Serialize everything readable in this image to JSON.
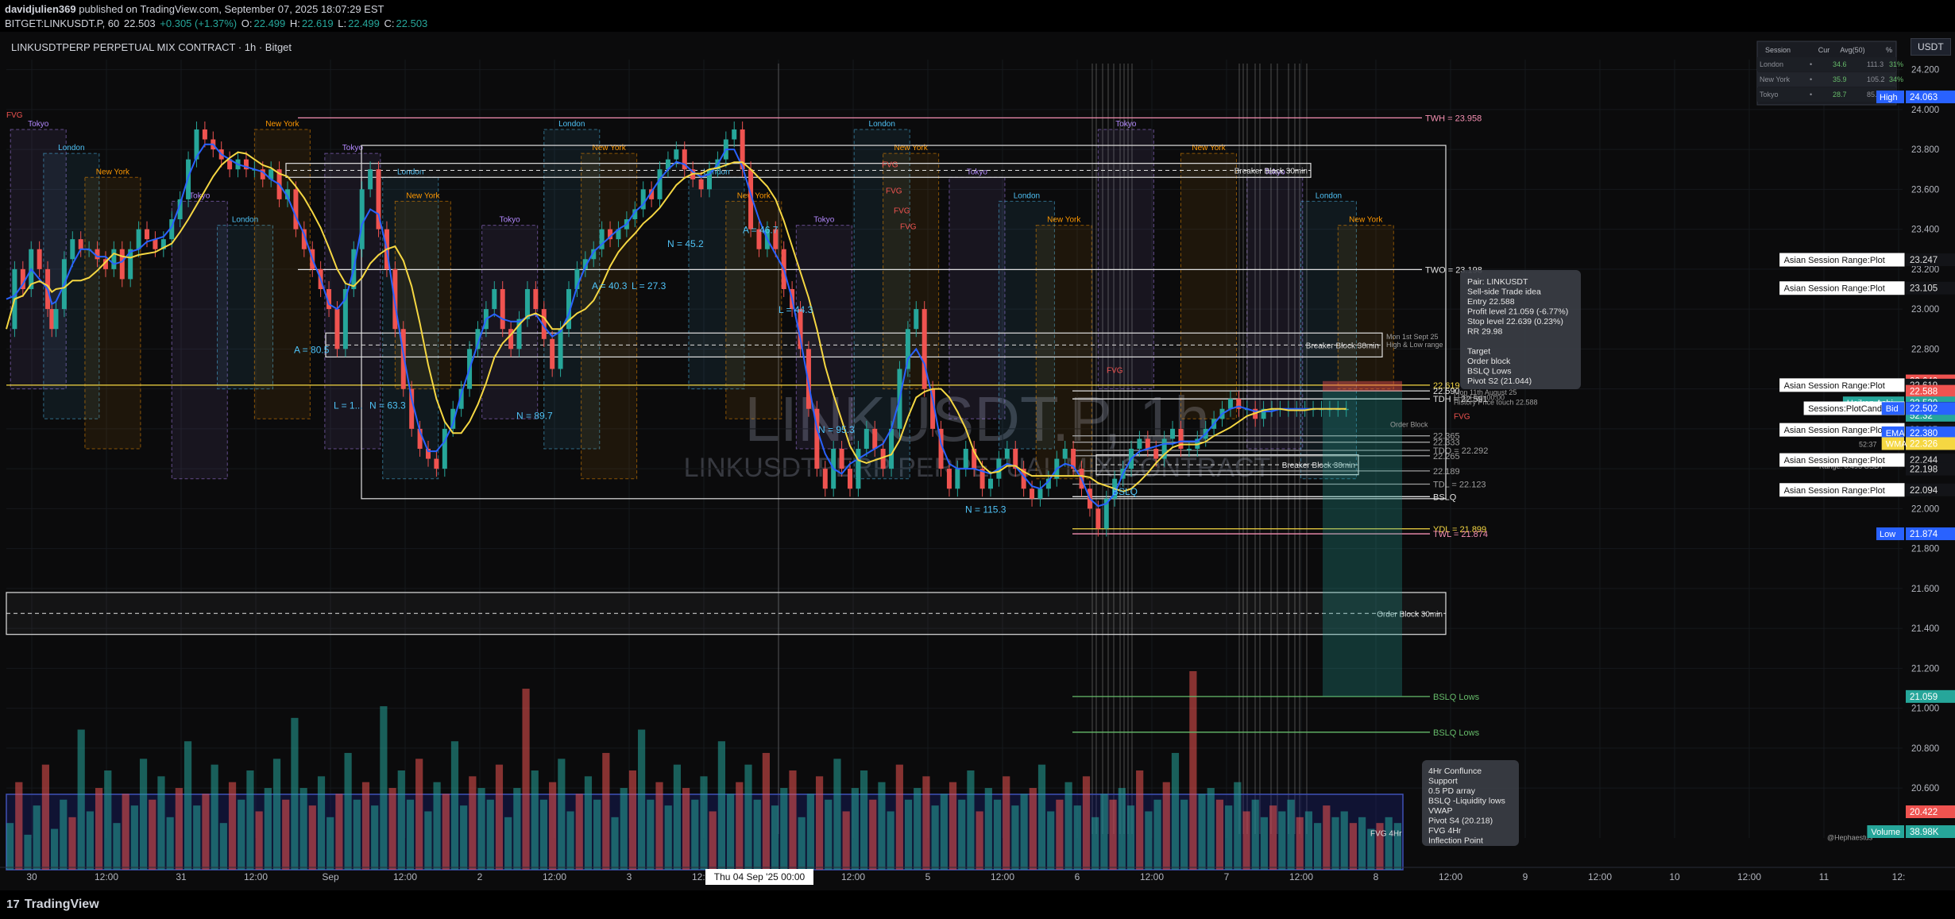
{
  "header": {
    "user": "davidjulien369",
    "published": "published on TradingView.com, September 07, 2025 18:07:29 EST",
    "symbol": "BITGET:LINKUSDT.P, 60",
    "last": "22.503",
    "change": "+0.305 (+1.37%)",
    "open_label": "O:",
    "open": "22.499",
    "high_label": "H:",
    "high": "22.619",
    "low_label": "L:",
    "low": "22.499",
    "close_label": "C:",
    "close": "22.503"
  },
  "chart_title": "LINKUSDTPERP PERPETUAL MIX CONTRACT · 1h · Bitget",
  "currency_button": "USDT",
  "watermark": {
    "big": "LINKUSDT.P, 1h",
    "small": "LINKUSDTPERP PERPETUAL MIX CONTRACT"
  },
  "session_table": {
    "headers": [
      "Session",
      "Cur",
      "Avg(50)",
      "%"
    ],
    "rows": [
      [
        "London",
        "•",
        "34.6",
        "111.3",
        "31%"
      ],
      [
        "New York",
        "•",
        "35.9",
        "105.2",
        "34%"
      ],
      [
        "Tokyo",
        "•",
        "28.7",
        "85.6",
        ""
      ]
    ]
  },
  "footer": {
    "logo": "TradingView",
    "logo_mark": "17"
  },
  "colors": {
    "bull": "#26a69a",
    "bear": "#ef5350",
    "ema": "#2962ff",
    "wma": "#f5d742",
    "tokyo": "#b388ff",
    "london": "#4fc3f7",
    "newyork": "#ff9800",
    "bg": "#0b0b0c"
  },
  "chart_data": {
    "type": "line",
    "title": "LINKUSDTPERP PERPETUAL MIX CONTRACT · 1h · Bitget",
    "ylim": [
      20.3,
      24.25
    ],
    "y_ticks": [
      "24.200",
      "24.000",
      "23.800",
      "23.600",
      "23.400",
      "23.200",
      "23.000",
      "22.800",
      "22.600",
      "22.400",
      "22.200",
      "22.000",
      "21.800",
      "21.600",
      "21.400",
      "21.200",
      "21.000",
      "20.800",
      "20.600"
    ],
    "x_ticks": [
      "30",
      "12:00",
      "31",
      "12:00",
      "Sep",
      "12:00",
      "2",
      "12:00",
      "3",
      "12:00",
      "Thu 04 Sep '25   00:00",
      "12:00",
      "5",
      "12:00",
      "6",
      "12:00",
      "7",
      "12:00",
      "8",
      "12:00",
      "9",
      "12:00",
      "10",
      "12:00",
      "11",
      "12:"
    ],
    "price_series": {
      "name": "LINKUSDT.P",
      "t": [
        0,
        10,
        20,
        30,
        40,
        50,
        55,
        60,
        70,
        80,
        90,
        100,
        110,
        120,
        130,
        140,
        150,
        160,
        170,
        180,
        190,
        200,
        210,
        220,
        230,
        240,
        250,
        260,
        270,
        280,
        290,
        300,
        310,
        320,
        330,
        340,
        350,
        360,
        370,
        380,
        390,
        400,
        410,
        420,
        430,
        440,
        450,
        460,
        470,
        480,
        490,
        500,
        510,
        520,
        530,
        540,
        550,
        560,
        570,
        580,
        590,
        600,
        610,
        620,
        630,
        640,
        650,
        660,
        670,
        680,
        690,
        700,
        710,
        720,
        730,
        740,
        750,
        760,
        770,
        780,
        790,
        800,
        810,
        820,
        830,
        840,
        850,
        860,
        870,
        880,
        890,
        900,
        910,
        920,
        930,
        940,
        950,
        960,
        970,
        980,
        990,
        1000,
        1010,
        1020,
        1030,
        1040,
        1050,
        1060,
        1070,
        1080,
        1090,
        1100,
        1110,
        1120,
        1130,
        1140,
        1150,
        1160,
        1170,
        1180,
        1190,
        1200,
        1210,
        1220,
        1230,
        1240,
        1250,
        1260,
        1270,
        1280,
        1290,
        1300,
        1310,
        1320,
        1330,
        1340,
        1350,
        1360,
        1370,
        1380,
        1390,
        1400,
        1410,
        1420,
        1430,
        1440,
        1450,
        1460,
        1470,
        1480,
        1490,
        1500,
        1510,
        1520,
        1530,
        1540,
        1550,
        1560,
        1570,
        1580,
        1590,
        1600,
        1610,
        1620,
        1630,
        1640,
        1650,
        1660,
        1670,
        1680,
        1690
      ],
      "values": [
        22.9,
        23.2,
        23.1,
        23.3,
        23.2,
        23.0,
        22.9,
        23.0,
        23.25,
        23.35,
        23.3,
        23.3,
        23.25,
        23.2,
        23.3,
        23.15,
        23.3,
        23.4,
        23.35,
        23.3,
        23.35,
        23.45,
        23.55,
        23.75,
        23.9,
        23.85,
        23.8,
        23.75,
        23.7,
        23.75,
        23.7,
        23.7,
        23.65,
        23.7,
        23.55,
        23.6,
        23.4,
        23.3,
        23.2,
        23.1,
        23.0,
        22.8,
        23.1,
        23.3,
        23.6,
        23.7,
        23.4,
        23.2,
        22.9,
        22.6,
        22.4,
        22.3,
        22.25,
        22.2,
        22.4,
        22.5,
        22.6,
        22.8,
        22.9,
        23.0,
        23.1,
        22.9,
        22.8,
        22.95,
        23.1,
        23.0,
        22.85,
        22.7,
        22.9,
        23.1,
        23.2,
        23.25,
        23.3,
        23.4,
        23.35,
        23.4,
        23.45,
        23.5,
        23.6,
        23.55,
        23.7,
        23.75,
        23.8,
        23.7,
        23.65,
        23.6,
        23.7,
        23.75,
        23.85,
        23.9,
        23.7,
        23.4,
        23.3,
        23.4,
        23.3,
        23.1,
        23.0,
        22.8,
        22.5,
        22.2,
        22.1,
        22.3,
        22.2,
        22.1,
        22.3,
        22.4,
        22.3,
        22.2,
        22.4,
        22.7,
        22.9,
        23.0,
        22.6,
        22.4,
        22.2,
        22.1,
        22.2,
        22.3,
        22.2,
        22.1,
        22.15,
        22.25,
        22.3,
        22.2,
        22.1,
        22.05,
        22.1,
        22.15,
        22.25,
        22.3,
        22.2,
        22.1,
        22.0,
        21.9,
        22.05,
        22.15,
        22.2,
        22.3,
        22.35,
        22.3,
        22.25,
        22.35,
        22.4,
        22.3,
        22.3,
        22.35,
        22.4,
        22.45,
        22.5,
        22.55,
        22.5,
        22.5,
        22.45,
        22.5,
        22.5,
        22.5,
        22.5,
        22.5,
        22.5,
        22.5,
        22.5,
        22.5,
        22.5,
        22.5
      ]
    },
    "ema_label": "EMA",
    "ema_value": "22.380",
    "wma_label": "WMA",
    "wma_value": "22.326",
    "price_tags": [
      {
        "label": "",
        "value": "24.063",
        "name": "High",
        "color": "#2962ff"
      },
      {
        "label": "Asian Session Range:Plot",
        "value": "23.247",
        "color": "#0b0b0c"
      },
      {
        "label": "Asian Session Range:Plot",
        "value": "23.105",
        "color": "#0b0b0c"
      },
      {
        "label": "",
        "value": "22.640",
        "color": "#ef5350"
      },
      {
        "label": "Asian Session Range:Plot",
        "value": "22.619",
        "color": "#0b0b0c"
      },
      {
        "label": "",
        "value": "22.588",
        "color": "#ef5350"
      },
      {
        "label": "Heiken Ashi",
        "value": "22.530",
        "color": "#26a69a"
      },
      {
        "label": "Ask",
        "value": "22.503",
        "color": "#ef5350"
      },
      {
        "label": "LINKUSDT.P",
        "value": "22.503",
        "color": "#26a69a"
      },
      {
        "label": "",
        "value": "52:32",
        "color": "#26a69a"
      },
      {
        "label": "Sessions:PlotCandle",
        "value": "22.503",
        "color": "#0b0b0c"
      },
      {
        "label": "Bid",
        "value": "22.502",
        "color": "#2962ff"
      },
      {
        "label": "Asian Session Range:Plot",
        "value": "22.395",
        "color": "#0b0b0c"
      },
      {
        "label": "EMA",
        "value": "22.380",
        "color": "#2962ff"
      },
      {
        "label": "WMA",
        "value": "22.326",
        "color": "#f5d742"
      },
      {
        "label": "Asian Session Range:Plot",
        "value": "22.244",
        "color": "#0b0b0c"
      },
      {
        "label": "",
        "value": "22.198",
        "color": "#0b0b0c"
      },
      {
        "label": "Asian Session Range:Plot",
        "value": "22.094",
        "color": "#0b0b0c"
      },
      {
        "label": "",
        "value": "21.874",
        "name": "Low",
        "color": "#2962ff"
      },
      {
        "label": "",
        "value": "21.059",
        "color": "#26a69a"
      },
      {
        "label": "",
        "value": "20.422",
        "color": "#ef5350"
      },
      {
        "label": "Volume",
        "value": "38.98K",
        "color": "#26a69a"
      }
    ],
    "levels": [
      {
        "label": "TWH = 23.958",
        "value": 23.958,
        "color": "#f48fb1"
      },
      {
        "label": "TWO = 23.198",
        "value": 23.198,
        "color": "#e0e0e0"
      },
      {
        "label": "22.619",
        "value": 22.619,
        "color": "#f5d742"
      },
      {
        "label": "22.590",
        "value": 22.59,
        "color": "#e0e0e0"
      },
      {
        "label": "TDH = 22.591",
        "value": 22.55,
        "color": "#e0e0e0"
      },
      {
        "label": "22.365",
        "value": 22.365,
        "color": "#9e9e9e"
      },
      {
        "label": "22.333",
        "value": 22.333,
        "color": "#9e9e9e"
      },
      {
        "label": "TDO = 22.292",
        "value": 22.292,
        "color": "#9e9e9e"
      },
      {
        "label": "22.265",
        "value": 22.265,
        "color": "#9e9e9e"
      },
      {
        "label": "22.189",
        "value": 22.189,
        "color": "#9e9e9e"
      },
      {
        "label": "TDL = 22.123",
        "value": 22.123,
        "color": "#9e9e9e"
      },
      {
        "label": "BSLQ",
        "value": 22.06,
        "color": "#e0e0e0"
      },
      {
        "label": "YDL = 21.899",
        "value": 21.899,
        "color": "#f5d742"
      },
      {
        "label": "TWL = 21.874",
        "value": 21.874,
        "color": "#f48fb1"
      },
      {
        "label": "BSLQ Lows",
        "value": 21.059,
        "color": "#66bb6a"
      },
      {
        "label": "BSLQ Lows",
        "value": 20.88,
        "color": "#66bb6a"
      }
    ],
    "boxes": [
      {
        "label": "Breaker Block 30min",
        "y1": 23.73,
        "y2": 23.66
      },
      {
        "label": "Breaker Block 30min",
        "y1": 22.88,
        "y2": 22.76
      },
      {
        "label": "Order Block 30min",
        "y1": 21.58,
        "y2": 21.37
      },
      {
        "label": "Breaker Block 30min",
        "y1": 22.27,
        "y2": 22.17
      }
    ],
    "sessions": [
      {
        "name": "Tokyo",
        "t": 5
      },
      {
        "name": "London",
        "t": 45
      },
      {
        "name": "New York",
        "t": 95
      },
      {
        "name": "Tokyo",
        "t": 200
      },
      {
        "name": "London",
        "t": 255
      },
      {
        "name": "New York",
        "t": 300
      },
      {
        "name": "Tokyo",
        "t": 385
      },
      {
        "name": "London",
        "t": 455
      },
      {
        "name": "New York",
        "t": 470
      },
      {
        "name": "Tokyo",
        "t": 575
      },
      {
        "name": "London",
        "t": 650
      },
      {
        "name": "New York",
        "t": 695
      },
      {
        "name": "London",
        "t": 825
      },
      {
        "name": "New York",
        "t": 870
      },
      {
        "name": "Tokyo",
        "t": 955
      },
      {
        "name": "London",
        "t": 1025
      },
      {
        "name": "New York",
        "t": 1060
      },
      {
        "name": "Tokyo",
        "t": 1140
      },
      {
        "name": "London",
        "t": 1200
      },
      {
        "name": "New York",
        "t": 1245
      },
      {
        "name": "Tokyo",
        "t": 1320
      },
      {
        "name": "New York",
        "t": 1420
      },
      {
        "name": "Tokyo",
        "t": 1500
      },
      {
        "name": "London",
        "t": 1565
      },
      {
        "name": "New York",
        "t": 1610
      }
    ],
    "stats": [
      {
        "text": "A = 80.5",
        "t": 370,
        "v": 22.78
      },
      {
        "text": "L = 1...",
        "t": 420,
        "v": 22.5
      },
      {
        "text": "N = 63.3",
        "t": 465,
        "v": 22.5
      },
      {
        "text": "N = 89.7",
        "t": 650,
        "v": 22.45
      },
      {
        "text": "A = 40.3",
        "t": 745,
        "v": 23.1
      },
      {
        "text": "L = 27.3",
        "t": 795,
        "v": 23.1
      },
      {
        "text": "N = 45.2",
        "t": 840,
        "v": 23.31
      },
      {
        "text": "A = 46.7",
        "t": 935,
        "v": 23.38
      },
      {
        "text": "L = 44.3",
        "t": 980,
        "v": 22.98
      },
      {
        "text": "N = 95.3",
        "t": 1030,
        "v": 22.38
      },
      {
        "text": "N = 115.3",
        "t": 1215,
        "v": 21.98
      },
      {
        "text": "BSLQ",
        "t": 1400,
        "v": 22.07
      }
    ],
    "fvg": [
      {
        "text": "FVG",
        "t": 8,
        "v": 23.96
      },
      {
        "text": "FVG",
        "t": 1110,
        "v": 23.71
      },
      {
        "text": "FVG",
        "t": 1115,
        "v": 23.58
      },
      {
        "text": "FVG",
        "t": 1125,
        "v": 23.48
      },
      {
        "text": "FVG",
        "t": 1133,
        "v": 23.4
      },
      {
        "text": "FVG",
        "t": 1393,
        "v": 22.68
      },
      {
        "text": "FVG",
        "t": 1830,
        "v": 22.45
      },
      {
        "text": "FVG 4Hr",
        "t": 1725,
        "v": 20.36
      }
    ],
    "trade_idea": {
      "lines": [
        "Pair: LINKUSDT",
        "Sell-side Trade idea",
        "Entry 22.588",
        "Profit level 21.059 (-6.77%)",
        "Stop level 22.639 (0.23%)",
        "RR 29.98",
        "",
        "Target",
        "Order block",
        "BSLQ Lows",
        "Pivot S2 (21.044)"
      ]
    },
    "confluence": {
      "lines": [
        "4Hr Conflunce",
        "Support",
        "0.5 PD array",
        "BSLQ -Liquidity lows",
        "VWAP",
        "Pivot S4 (20.218)",
        "FVG 4Hr",
        "Inflection Point"
      ]
    },
    "small_notes": [
      {
        "text": "Mon 1st Sept 25",
        "t": 1745,
        "v": 22.85
      },
      {
        "text": "High & Low range",
        "t": 1745,
        "v": 22.81
      },
      {
        "text": "Mon 11th August 25",
        "t": 1830,
        "v": 22.57
      },
      {
        "text": "LHD High 00:00",
        "t": 1830,
        "v": 22.545
      },
      {
        "text": "History Price touch 22.588",
        "t": 1830,
        "v": 22.52
      },
      {
        "text": "Order Block",
        "t": 1750,
        "v": 22.41
      },
      {
        "text": "1D CANDLE RC",
        "t": 2300,
        "v": 22.39
      },
      {
        "text": "Range: 0.496 USDT",
        "t": 2290,
        "v": 22.2
      },
      {
        "text": "52:37",
        "t": 2340,
        "v": 22.31
      },
      {
        "text": "@Hephaestus",
        "t": 2300,
        "v": 20.34
      }
    ],
    "volume": {
      "name": "Volume",
      "last": "38.98K",
      "values": [
        40,
        75,
        30,
        55,
        90,
        35,
        60,
        45,
        120,
        50,
        70,
        85,
        40,
        65,
        55,
        95,
        60,
        80,
        45,
        70,
        110,
        55,
        65,
        90,
        40,
        75,
        60,
        85,
        50,
        70,
        95,
        60,
        130,
        70,
        55,
        80,
        45,
        65,
        100,
        60,
        75,
        55,
        140,
        70,
        85,
        60,
        95,
        50,
        75,
        65,
        110,
        55,
        80,
        70,
        60,
        90,
        45,
        70,
        155,
        85,
        60,
        75,
        95,
        50,
        65,
        80,
        60,
        100,
        45,
        70,
        85,
        120,
        60,
        75,
        55,
        90,
        70,
        60,
        80,
        50,
        110,
        65,
        75,
        90,
        60,
        100,
        55,
        70,
        85,
        45,
        65,
        80,
        60,
        95,
        50,
        70,
        85,
        60,
        75,
        50,
        90,
        60,
        70,
        80,
        55,
        65,
        75,
        60,
        85,
        50,
        70,
        60,
        80,
        55,
        65,
        70,
        90,
        50,
        60,
        75,
        55,
        80,
        45,
        65,
        60,
        70,
        55,
        85,
        50,
        60,
        75,
        100,
        60,
        170,
        65,
        70,
        60,
        55,
        75,
        50,
        60,
        45,
        55,
        50,
        60,
        45,
        50,
        40,
        55,
        45,
        50,
        40,
        45,
        35,
        40,
        45,
        40
      ]
    }
  }
}
